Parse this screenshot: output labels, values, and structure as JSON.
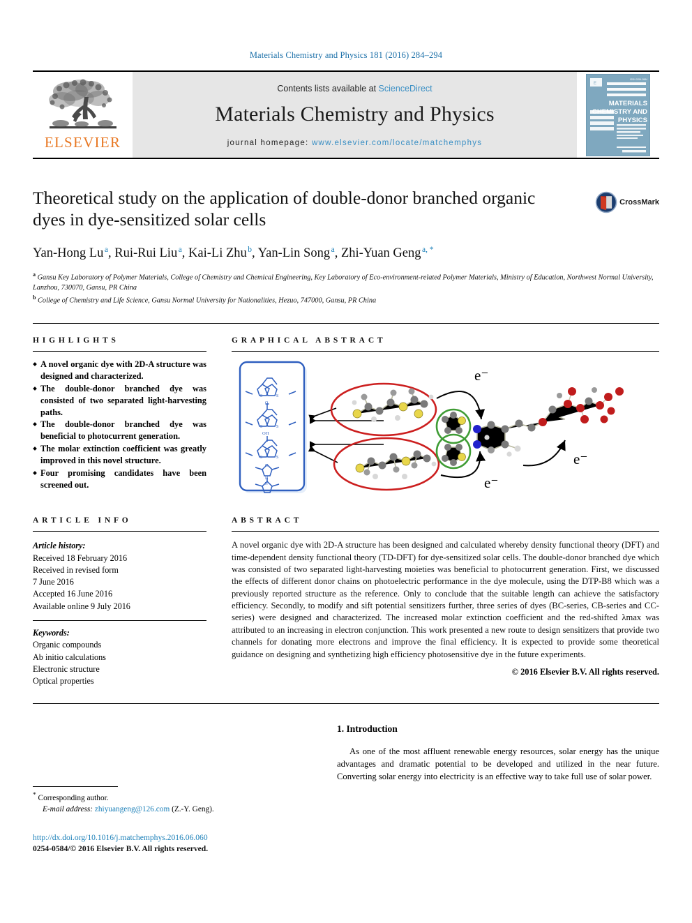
{
  "running_head": "Materials Chemistry and Physics 181 (2016) 284–294",
  "masthead": {
    "publisher_name": "ELSEVIER",
    "contents_prefix": "Contents lists available at ",
    "contents_link": "ScienceDirect",
    "journal_name": "Materials Chemistry and Physics",
    "homepage_label": "journal homepage:",
    "homepage_url": "www.elsevier.com/locate/matchemphys",
    "cover_title_line1": "MATERIALS",
    "cover_title_line2": "CHEMISTRY AND",
    "cover_title_line3": "PHYSICS",
    "link_color": "#3a8fc4",
    "band_color": "#e6e6e6",
    "elsevier_orange": "#E87722",
    "cover_blue": "#7fa8bf"
  },
  "article": {
    "title": "Theoretical study on the application of double-donor branched organic dyes in dye-sensitized solar cells",
    "crossmark_label": "CrossMark",
    "authors": [
      {
        "name": "Yan-Hong Lu",
        "sup": "a",
        "sep": ","
      },
      {
        "name": "Rui-Rui Liu",
        "sup": "a",
        "sep": ","
      },
      {
        "name": "Kai-Li Zhu",
        "sup": "b",
        "sep": ","
      },
      {
        "name": "Yan-Lin Song",
        "sup": "a",
        "sep": ","
      },
      {
        "name": "Zhi-Yuan Geng",
        "sup": "a, *",
        "sep": ""
      }
    ],
    "affiliations": [
      {
        "sup": "a",
        "text": "Gansu Key Laboratory of Polymer Materials, College of Chemistry and Chemical Engineering, Key Laboratory of Eco-environment-related Polymer Materials, Ministry of Education, Northwest Normal University, Lanzhou, 730070, Gansu, PR China"
      },
      {
        "sup": "b",
        "text": "College of Chemistry and Life Science, Gansu Normal University for Nationalities, Hezuo, 747000, Gansu, PR China"
      }
    ]
  },
  "highlights": {
    "heading": "HIGHLIGHTS",
    "items": [
      "A novel organic dye with 2D-A structure was designed and characterized.",
      "The double-donor branched dye was consisted of two separated light-harvesting paths.",
      "The double-donor branched dye was beneficial to photocurrent generation.",
      "The molar extinction coefficient was greatly improved in this novel structure.",
      "Four promising candidates have been screened out."
    ]
  },
  "graphical_abstract": {
    "heading": "GRAPHICAL ABSTRACT",
    "electron_labels": [
      "e−",
      "e−",
      "e−"
    ],
    "atom_labels": [
      "S",
      "S",
      "O",
      "OH",
      "H",
      "N",
      "O"
    ],
    "panel_border_color": "#2f5fbf",
    "ellipse_color": "#cc1f1f",
    "circle_color": "#3f9c35"
  },
  "article_info": {
    "heading": "ARTICLE INFO",
    "history_label": "Article history:",
    "history": [
      "Received 18 February 2016",
      "Received in revised form",
      "7 June 2016",
      "Accepted 16 June 2016",
      "Available online 9 July 2016"
    ],
    "keywords_label": "Keywords:",
    "keywords": [
      "Organic compounds",
      "Ab initio calculations",
      "Electronic structure",
      "Optical properties"
    ]
  },
  "abstract": {
    "heading": "ABSTRACT",
    "text": "A novel organic dye with 2D-A structure has been designed and calculated whereby density functional theory (DFT) and time-dependent density functional theory (TD-DFT) for dye-sensitized solar cells. The double-donor branched dye which was consisted of two separated light-harvesting moieties was beneficial to photocurrent generation. First, we discussed the effects of different donor chains on photoelectric performance in the dye molecule, using the DTP-B8 which was a previously reported structure as the reference. Only to conclude that the suitable length can achieve the satisfactory efficiency. Secondly, to modify and sift potential sensitizers further, three series of dyes (BC-series, CB-series and CC-series) were designed and characterized. The increased molar extinction coefficient and the red-shifted λmax was attributed to an increasing in electron conjunction. This work presented a new route to design sensitizers that provide two channels for donating more electrons and improve the final efficiency. It is expected to provide some theoretical guidance on designing and synthetizing high efficiency photosensitive dye in the future experiments.",
    "copyright": "© 2016 Elsevier B.V. All rights reserved."
  },
  "introduction": {
    "heading": "1. Introduction",
    "paragraph": "As one of the most affluent renewable energy resources, solar energy has the unique advantages and dramatic potential to be developed and utilized in the near future. Converting solar energy into electricity is an effective way to take full use of solar power."
  },
  "footer": {
    "corresponding_marker": "*",
    "corresponding_text": "Corresponding author.",
    "email_label": "E-mail address:",
    "email": "zhiyuangeng@126.com",
    "email_owner": "(Z.-Y. Geng).",
    "doi_url": "http://dx.doi.org/10.1016/j.matchemphys.2016.06.060",
    "issn_line": "0254-0584/© 2016 Elsevier B.V. All rights reserved."
  }
}
